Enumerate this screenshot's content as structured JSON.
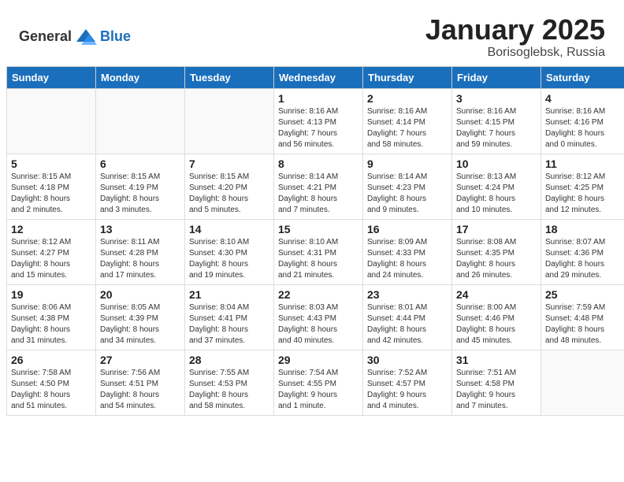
{
  "header": {
    "logo_general": "General",
    "logo_blue": "Blue",
    "month": "January 2025",
    "location": "Borisoglebsk, Russia"
  },
  "days_of_week": [
    "Sunday",
    "Monday",
    "Tuesday",
    "Wednesday",
    "Thursday",
    "Friday",
    "Saturday"
  ],
  "weeks": [
    [
      {
        "day": "",
        "info": ""
      },
      {
        "day": "",
        "info": ""
      },
      {
        "day": "",
        "info": ""
      },
      {
        "day": "1",
        "info": "Sunrise: 8:16 AM\nSunset: 4:13 PM\nDaylight: 7 hours\nand 56 minutes."
      },
      {
        "day": "2",
        "info": "Sunrise: 8:16 AM\nSunset: 4:14 PM\nDaylight: 7 hours\nand 58 minutes."
      },
      {
        "day": "3",
        "info": "Sunrise: 8:16 AM\nSunset: 4:15 PM\nDaylight: 7 hours\nand 59 minutes."
      },
      {
        "day": "4",
        "info": "Sunrise: 8:16 AM\nSunset: 4:16 PM\nDaylight: 8 hours\nand 0 minutes."
      }
    ],
    [
      {
        "day": "5",
        "info": "Sunrise: 8:15 AM\nSunset: 4:18 PM\nDaylight: 8 hours\nand 2 minutes."
      },
      {
        "day": "6",
        "info": "Sunrise: 8:15 AM\nSunset: 4:19 PM\nDaylight: 8 hours\nand 3 minutes."
      },
      {
        "day": "7",
        "info": "Sunrise: 8:15 AM\nSunset: 4:20 PM\nDaylight: 8 hours\nand 5 minutes."
      },
      {
        "day": "8",
        "info": "Sunrise: 8:14 AM\nSunset: 4:21 PM\nDaylight: 8 hours\nand 7 minutes."
      },
      {
        "day": "9",
        "info": "Sunrise: 8:14 AM\nSunset: 4:23 PM\nDaylight: 8 hours\nand 9 minutes."
      },
      {
        "day": "10",
        "info": "Sunrise: 8:13 AM\nSunset: 4:24 PM\nDaylight: 8 hours\nand 10 minutes."
      },
      {
        "day": "11",
        "info": "Sunrise: 8:12 AM\nSunset: 4:25 PM\nDaylight: 8 hours\nand 12 minutes."
      }
    ],
    [
      {
        "day": "12",
        "info": "Sunrise: 8:12 AM\nSunset: 4:27 PM\nDaylight: 8 hours\nand 15 minutes."
      },
      {
        "day": "13",
        "info": "Sunrise: 8:11 AM\nSunset: 4:28 PM\nDaylight: 8 hours\nand 17 minutes."
      },
      {
        "day": "14",
        "info": "Sunrise: 8:10 AM\nSunset: 4:30 PM\nDaylight: 8 hours\nand 19 minutes."
      },
      {
        "day": "15",
        "info": "Sunrise: 8:10 AM\nSunset: 4:31 PM\nDaylight: 8 hours\nand 21 minutes."
      },
      {
        "day": "16",
        "info": "Sunrise: 8:09 AM\nSunset: 4:33 PM\nDaylight: 8 hours\nand 24 minutes."
      },
      {
        "day": "17",
        "info": "Sunrise: 8:08 AM\nSunset: 4:35 PM\nDaylight: 8 hours\nand 26 minutes."
      },
      {
        "day": "18",
        "info": "Sunrise: 8:07 AM\nSunset: 4:36 PM\nDaylight: 8 hours\nand 29 minutes."
      }
    ],
    [
      {
        "day": "19",
        "info": "Sunrise: 8:06 AM\nSunset: 4:38 PM\nDaylight: 8 hours\nand 31 minutes."
      },
      {
        "day": "20",
        "info": "Sunrise: 8:05 AM\nSunset: 4:39 PM\nDaylight: 8 hours\nand 34 minutes."
      },
      {
        "day": "21",
        "info": "Sunrise: 8:04 AM\nSunset: 4:41 PM\nDaylight: 8 hours\nand 37 minutes."
      },
      {
        "day": "22",
        "info": "Sunrise: 8:03 AM\nSunset: 4:43 PM\nDaylight: 8 hours\nand 40 minutes."
      },
      {
        "day": "23",
        "info": "Sunrise: 8:01 AM\nSunset: 4:44 PM\nDaylight: 8 hours\nand 42 minutes."
      },
      {
        "day": "24",
        "info": "Sunrise: 8:00 AM\nSunset: 4:46 PM\nDaylight: 8 hours\nand 45 minutes."
      },
      {
        "day": "25",
        "info": "Sunrise: 7:59 AM\nSunset: 4:48 PM\nDaylight: 8 hours\nand 48 minutes."
      }
    ],
    [
      {
        "day": "26",
        "info": "Sunrise: 7:58 AM\nSunset: 4:50 PM\nDaylight: 8 hours\nand 51 minutes."
      },
      {
        "day": "27",
        "info": "Sunrise: 7:56 AM\nSunset: 4:51 PM\nDaylight: 8 hours\nand 54 minutes."
      },
      {
        "day": "28",
        "info": "Sunrise: 7:55 AM\nSunset: 4:53 PM\nDaylight: 8 hours\nand 58 minutes."
      },
      {
        "day": "29",
        "info": "Sunrise: 7:54 AM\nSunset: 4:55 PM\nDaylight: 9 hours\nand 1 minute."
      },
      {
        "day": "30",
        "info": "Sunrise: 7:52 AM\nSunset: 4:57 PM\nDaylight: 9 hours\nand 4 minutes."
      },
      {
        "day": "31",
        "info": "Sunrise: 7:51 AM\nSunset: 4:58 PM\nDaylight: 9 hours\nand 7 minutes."
      },
      {
        "day": "",
        "info": ""
      }
    ]
  ]
}
